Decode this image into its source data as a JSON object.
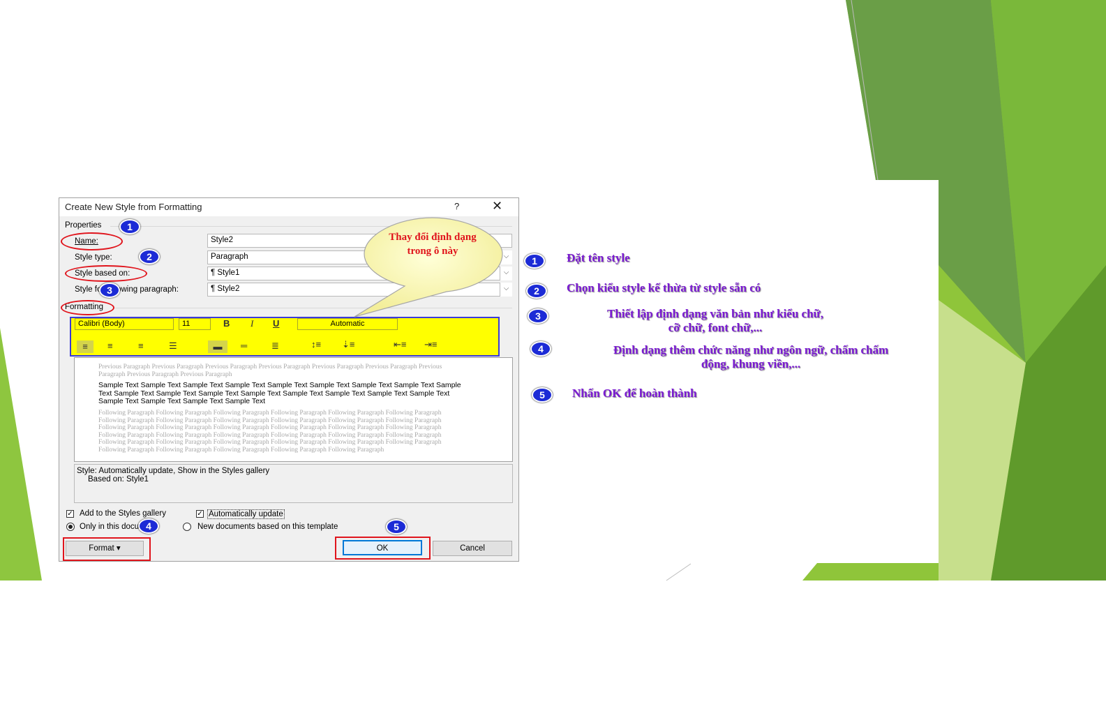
{
  "dialog": {
    "title": "Create New Style from Formatting",
    "help": "?",
    "close": "✕",
    "properties_label": "Properties",
    "name_label": "Name:",
    "name_value": "Style2",
    "style_type_label": "Style type:",
    "style_type_value": "Paragraph",
    "based_on_label": "Style based on:",
    "based_on_value": "¶  Style1",
    "following_label": "Style for following paragraph:",
    "following_value": "¶  Style2",
    "formatting_label": "Formatting",
    "font": "Calibri (Body)",
    "size": "11",
    "bold": "B",
    "italic": "I",
    "underline": "U",
    "color": "Automatic",
    "preview_previous": "Previous Paragraph Previous Paragraph Previous Paragraph Previous Paragraph Previous Paragraph Previous Paragraph Previous Paragraph Previous Paragraph Previous Paragraph",
    "preview_sample": "Sample Text Sample Text Sample Text Sample Text Sample Text Sample Text Sample Text Sample Text Sample Text Sample Text Sample Text Sample Text Sample Text Sample Text Sample Text Sample Text Sample Text Sample Text Sample Text Sample Text Sample Text",
    "preview_following": "Following Paragraph Following Paragraph Following Paragraph Following Paragraph Following Paragraph Following Paragraph Following Paragraph Following Paragraph Following Paragraph Following Paragraph Following Paragraph Following Paragraph Following Paragraph Following Paragraph Following Paragraph Following Paragraph Following Paragraph Following Paragraph Following Paragraph Following Paragraph Following Paragraph Following Paragraph Following Paragraph Following Paragraph Following Paragraph Following Paragraph Following Paragraph Following Paragraph Following Paragraph Following Paragraph Following Paragraph Following Paragraph Following Paragraph Following Paragraph Following Paragraph",
    "description_line1": "Style: Automatically update, Show in the Styles gallery",
    "description_line2": "Based on: Style1",
    "add_gallery_label": "Add to the Styles gallery",
    "auto_update_label": "Automatically update",
    "only_doc_label": "Only in this document",
    "new_docs_label": "New documents based on this template",
    "format_button": "Format ▾",
    "ok_button": "OK",
    "cancel_button": "Cancel"
  },
  "callout": {
    "text": "Thay đổi định dạng trong ô này"
  },
  "badges": [
    "1",
    "2",
    "3",
    "4",
    "5"
  ],
  "notes": [
    {
      "num": "1",
      "text": "Đặt tên style"
    },
    {
      "num": "2",
      "text": "Chọn kiểu style kế thừa từ style sẵn có"
    },
    {
      "num": "3",
      "line1": "Thiết lập định dạng văn bản như kiểu chữ,",
      "line2": "cỡ chữ, font chữ,..."
    },
    {
      "num": "4",
      "line1": "Định dạng thêm chức năng như ngôn ngữ, chấm chấm",
      "line2": "động, khung viền,..."
    },
    {
      "num": "5",
      "text": "Nhấn OK để hoàn thành"
    }
  ],
  "colors": {
    "annotation": "#e0141c",
    "badge": "#1c2bd6",
    "note_text": "#7a1ad2",
    "highlight": "#ffff00",
    "highlight_border": "#3b3bd8",
    "green_dark": "#4e8a2e",
    "green_light": "#8fc53a"
  }
}
